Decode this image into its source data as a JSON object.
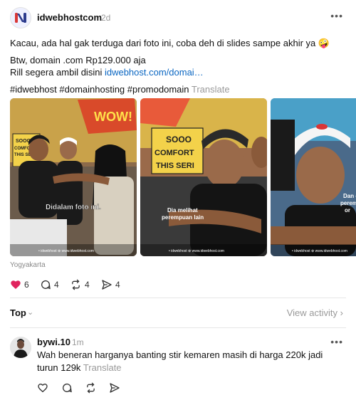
{
  "post": {
    "author": "idwebhostcom",
    "time": "2d",
    "more_label": "•••",
    "line1": "Kacau, ada hal gak terduga dari foto ini, coba deh di slides sampe akhir ya 🤪",
    "line2": "Btw, domain .com Rp129.000 aja",
    "line3_prefix": "Rill segera ambil disini ",
    "line3_link": "idwebhost.com/domai…",
    "hashtags": "#idwebhost #domainhosting #promodomain",
    "translate_label": "Translate",
    "location": "Yogyakarta",
    "slides": [
      {
        "caption": "Didalam foto ini.",
        "sign": "SOOO COMFORT THIS SER",
        "wow": "WOW!"
      },
      {
        "caption": "Dia melihat perempuan lain",
        "sign": "SOOO COMFORT THIS SERI"
      },
      {
        "caption": "Dan perem",
        "caption2": "or"
      }
    ],
    "slide_footer": "• idwebhost   ⊕ www.idwebhost.com",
    "stats": {
      "likes": "6",
      "replies": "4",
      "reposts": "4",
      "shares": "4"
    }
  },
  "sort": {
    "label": "Top",
    "view_activity": "View activity"
  },
  "reply": {
    "author": "bywi.10",
    "time": "1m",
    "more_label": "•••",
    "text": "Wah beneran harganya banting stir kemaren masih di harga 220k jadi turun 129k",
    "translate_label": "Translate"
  },
  "colors": {
    "like": "#e0245e",
    "link": "#0a66c2",
    "muted": "#9a9a9a",
    "brand_red": "#d93636"
  },
  "icons": [
    "heart-icon",
    "comment-icon",
    "repost-icon",
    "share-icon",
    "chevron-down-icon",
    "chevron-right-icon",
    "more-icon"
  ]
}
